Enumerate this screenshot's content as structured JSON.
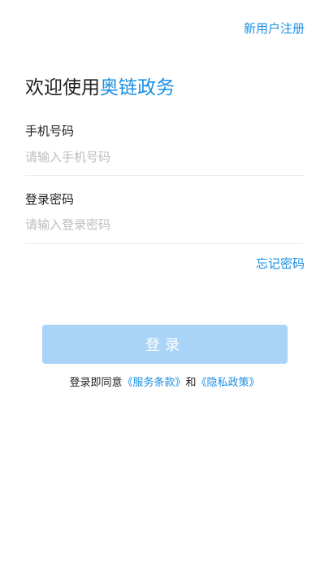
{
  "header": {
    "register_label": "新用户注册"
  },
  "welcome": {
    "prefix": "欢迎使用",
    "brand": "奥链政务"
  },
  "phone": {
    "label": "手机号码",
    "placeholder": "请输入手机号码",
    "value": ""
  },
  "password": {
    "label": "登录密码",
    "placeholder": "请输入登录密码",
    "value": ""
  },
  "forgot_label": "忘记密码",
  "login_label": "登录",
  "agreement": {
    "prefix": "登录即同意",
    "terms": "《服务条款》",
    "conjunction": "和",
    "privacy": "《隐私政策》"
  },
  "colors": {
    "accent": "#1a8fe3",
    "button_disabled": "#a9d3f7",
    "placeholder": "#bdbdbd",
    "divider": "#ececec"
  }
}
